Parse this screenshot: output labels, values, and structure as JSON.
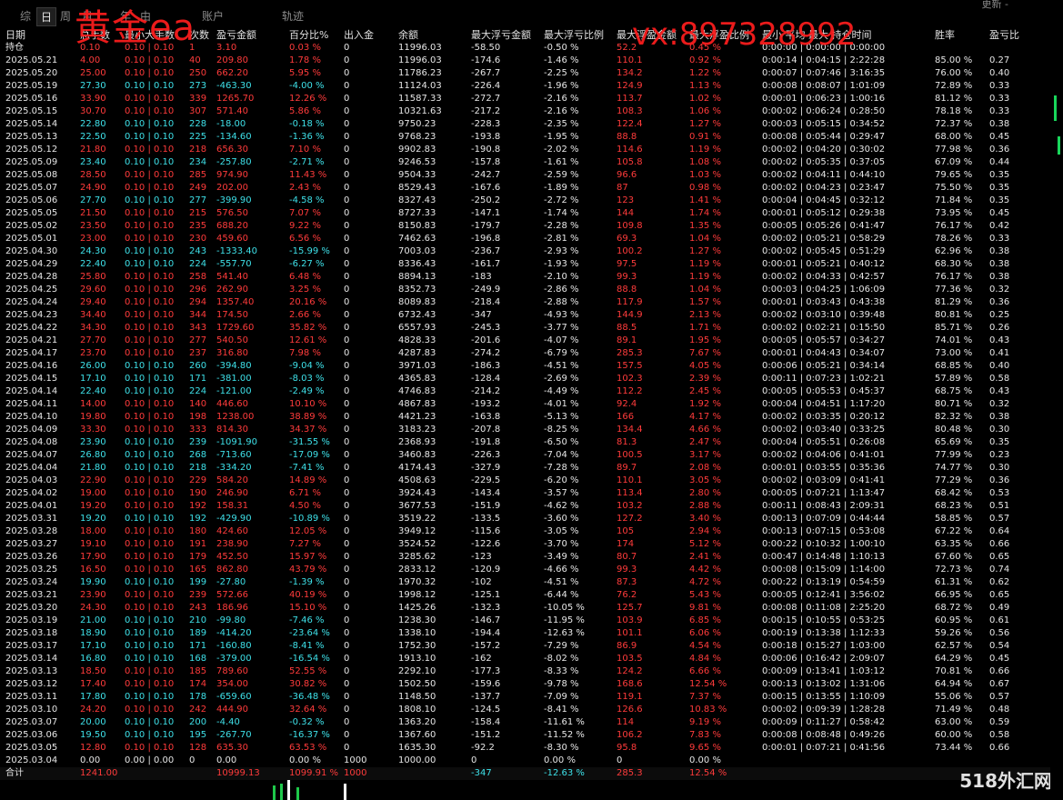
{
  "tabs": [
    "综",
    "日",
    "周",
    "月",
    "年",
    "由",
    "账户",
    "轨迹"
  ],
  "active_tab": "日",
  "watermark": {
    "title": "黄金ea",
    "contact": "vx:897328992",
    "logo": "518外汇网"
  },
  "top_right": "更新  -",
  "columns": [
    "日期",
    "总手数",
    "最小大手数",
    "次数",
    "盈亏金额",
    "百分比%",
    "出入金",
    "余额",
    "最大浮亏金额",
    "最大浮亏比例",
    "最大浮盈金额",
    "最大浮盈比例",
    "最小 平均 最大 持仓时间",
    "胜率",
    "盈亏比"
  ],
  "rows": [
    [
      "持仓",
      "0.10",
      "0.10 | 0.10",
      "1",
      "3.10",
      "0.03 %",
      "0",
      "11996.03",
      "-58.50",
      "-0.50 %",
      "52.2",
      "0.45 %",
      "0:00:00 | 0:00:00 | 0:00:00",
      "",
      ""
    ],
    [
      "2025.05.21",
      "4.00",
      "0.10 | 0.10",
      "40",
      "209.80",
      "1.78 %",
      "0",
      "11996.03",
      "-174.6",
      "-1.46 %",
      "110.1",
      "0.92 %",
      "0:00:14 | 0:04:15 | 2:22:28",
      "85.00 %",
      "0.27"
    ],
    [
      "2025.05.20",
      "25.00",
      "0.10 | 0.10",
      "250",
      "662.20",
      "5.95 %",
      "0",
      "11786.23",
      "-267.7",
      "-2.25 %",
      "134.2",
      "1.22 %",
      "0:00:07 | 0:07:46 | 3:16:35",
      "76.00 %",
      "0.40"
    ],
    [
      "2025.05.19",
      "27.30",
      "0.10 | 0.10",
      "273",
      "-463.30",
      "-4.00 %",
      "0",
      "11124.03",
      "-226.4",
      "-1.96 %",
      "124.9",
      "1.13 %",
      "0:00:08 | 0:08:07 | 1:01:09",
      "72.89 %",
      "0.33"
    ],
    [
      "2025.05.16",
      "33.90",
      "0.10 | 0.10",
      "339",
      "1265.70",
      "12.26 %",
      "0",
      "11587.33",
      "-272.7",
      "-2.16 %",
      "113.7",
      "1.02 %",
      "0:00:01 | 0:06:23 | 1:00:16",
      "81.12 %",
      "0.33"
    ],
    [
      "2025.05.15",
      "30.70",
      "0.10 | 0.10",
      "307",
      "571.40",
      "5.86 %",
      "0",
      "10321.63",
      "-217.2",
      "-2.16 %",
      "108.3",
      "1.06 %",
      "0:00:02 | 0:06:24 | 0:28:50",
      "78.18 %",
      "0.33"
    ],
    [
      "2025.05.14",
      "22.80",
      "0.10 | 0.10",
      "228",
      "-18.00",
      "-0.18 %",
      "0",
      "9750.23",
      "-228.3",
      "-2.35 %",
      "122.4",
      "1.27 %",
      "0:00:03 | 0:05:15 | 0:34:52",
      "72.37 %",
      "0.38"
    ],
    [
      "2025.05.13",
      "22.50",
      "0.10 | 0.10",
      "225",
      "-134.60",
      "-1.36 %",
      "0",
      "9768.23",
      "-193.8",
      "-1.95 %",
      "88.8",
      "0.91 %",
      "0:00:08 | 0:05:44 | 0:29:47",
      "68.00 %",
      "0.45"
    ],
    [
      "2025.05.12",
      "21.80",
      "0.10 | 0.10",
      "218",
      "656.30",
      "7.10 %",
      "0",
      "9902.83",
      "-190.8",
      "-2.02 %",
      "114.6",
      "1.19 %",
      "0:00:02 | 0:04:20 | 0:30:02",
      "77.98 %",
      "0.36"
    ],
    [
      "2025.05.09",
      "23.40",
      "0.10 | 0.10",
      "234",
      "-257.80",
      "-2.71 %",
      "0",
      "9246.53",
      "-157.8",
      "-1.61 %",
      "105.8",
      "1.08 %",
      "0:00:02 | 0:05:35 | 0:37:05",
      "67.09 %",
      "0.44"
    ],
    [
      "2025.05.08",
      "28.50",
      "0.10 | 0.10",
      "285",
      "974.90",
      "11.43 %",
      "0",
      "9504.33",
      "-242.7",
      "-2.59 %",
      "96.6",
      "1.03 %",
      "0:00:02 | 0:04:11 | 0:44:10",
      "79.65 %",
      "0.35"
    ],
    [
      "2025.05.07",
      "24.90",
      "0.10 | 0.10",
      "249",
      "202.00",
      "2.43 %",
      "0",
      "8529.43",
      "-167.6",
      "-1.89 %",
      "87",
      "0.98 %",
      "0:00:02 | 0:04:23 | 0:23:47",
      "75.50 %",
      "0.35"
    ],
    [
      "2025.05.06",
      "27.70",
      "0.10 | 0.10",
      "277",
      "-399.90",
      "-4.58 %",
      "0",
      "8327.43",
      "-250.2",
      "-2.72 %",
      "123",
      "1.41 %",
      "0:00:04 | 0:04:45 | 0:32:12",
      "71.84 %",
      "0.35"
    ],
    [
      "2025.05.05",
      "21.50",
      "0.10 | 0.10",
      "215",
      "576.50",
      "7.07 %",
      "0",
      "8727.33",
      "-147.1",
      "-1.74 %",
      "144",
      "1.74 %",
      "0:00:01 | 0:05:12 | 0:29:38",
      "73.95 %",
      "0.45"
    ],
    [
      "2025.05.02",
      "23.50",
      "0.10 | 0.10",
      "235",
      "688.20",
      "9.22 %",
      "0",
      "8150.83",
      "-179.7",
      "-2.28 %",
      "109.8",
      "1.35 %",
      "0:00:05 | 0:05:26 | 0:41:47",
      "76.17 %",
      "0.42"
    ],
    [
      "2025.05.01",
      "23.00",
      "0.10 | 0.10",
      "230",
      "459.60",
      "6.56 %",
      "0",
      "7462.63",
      "-196.8",
      "-2.81 %",
      "69.3",
      "1.04 %",
      "0:00:02 | 0:05:21 | 0:58:29",
      "78.26 %",
      "0.33"
    ],
    [
      "2025.04.30",
      "24.30",
      "0.10 | 0.10",
      "243",
      "-1333.40",
      "-15.99 %",
      "0",
      "7003.03",
      "-236.7",
      "-2.93 %",
      "100.2",
      "1.27 %",
      "0:00:02 | 0:05:45 | 0:51:29",
      "62.96 %",
      "0.38"
    ],
    [
      "2025.04.29",
      "22.40",
      "0.10 | 0.10",
      "224",
      "-557.70",
      "-6.27 %",
      "0",
      "8336.43",
      "-161.7",
      "-1.93 %",
      "97.5",
      "1.19 %",
      "0:00:01 | 0:05:21 | 0:40:12",
      "68.30 %",
      "0.38"
    ],
    [
      "2025.04.28",
      "25.80",
      "0.10 | 0.10",
      "258",
      "541.40",
      "6.48 %",
      "0",
      "8894.13",
      "-183",
      "-2.10 %",
      "99.3",
      "1.19 %",
      "0:00:02 | 0:04:33 | 0:42:57",
      "76.17 %",
      "0.38"
    ],
    [
      "2025.04.25",
      "29.60",
      "0.10 | 0.10",
      "296",
      "262.90",
      "3.25 %",
      "0",
      "8352.73",
      "-249.9",
      "-2.86 %",
      "88.8",
      "1.04 %",
      "0:00:03 | 0:04:25 | 1:06:09",
      "77.36 %",
      "0.32"
    ],
    [
      "2025.04.24",
      "29.40",
      "0.10 | 0.10",
      "294",
      "1357.40",
      "20.16 %",
      "0",
      "8089.83",
      "-218.4",
      "-2.88 %",
      "117.9",
      "1.57 %",
      "0:00:01 | 0:03:43 | 0:43:38",
      "81.29 %",
      "0.36"
    ],
    [
      "2025.04.23",
      "34.40",
      "0.10 | 0.10",
      "344",
      "174.50",
      "2.66 %",
      "0",
      "6732.43",
      "-347",
      "-4.93 %",
      "144.9",
      "2.13 %",
      "0:00:02 | 0:03:10 | 0:39:48",
      "80.81 %",
      "0.25"
    ],
    [
      "2025.04.22",
      "34.30",
      "0.10 | 0.10",
      "343",
      "1729.60",
      "35.82 %",
      "0",
      "6557.93",
      "-245.3",
      "-3.77 %",
      "88.5",
      "1.71 %",
      "0:00:02 | 0:02:21 | 0:15:50",
      "85.71 %",
      "0.26"
    ],
    [
      "2025.04.21",
      "27.70",
      "0.10 | 0.10",
      "277",
      "540.50",
      "12.61 %",
      "0",
      "4828.33",
      "-201.6",
      "-4.07 %",
      "89.1",
      "1.95 %",
      "0:00:05 | 0:05:57 | 0:34:27",
      "74.01 %",
      "0.43"
    ],
    [
      "2025.04.17",
      "23.70",
      "0.10 | 0.10",
      "237",
      "316.80",
      "7.98 %",
      "0",
      "4287.83",
      "-274.2",
      "-6.79 %",
      "285.3",
      "7.67 %",
      "0:00:01 | 0:04:43 | 0:34:07",
      "73.00 %",
      "0.41"
    ],
    [
      "2025.04.16",
      "26.00",
      "0.10 | 0.10",
      "260",
      "-394.80",
      "-9.04 %",
      "0",
      "3971.03",
      "-186.3",
      "-4.51 %",
      "157.5",
      "4.05 %",
      "0:00:06 | 0:05:21 | 0:34:14",
      "68.85 %",
      "0.40"
    ],
    [
      "2025.04.15",
      "17.10",
      "0.10 | 0.10",
      "171",
      "-381.00",
      "-8.03 %",
      "0",
      "4365.83",
      "-128.4",
      "-2.69 %",
      "102.3",
      "2.39 %",
      "0:00:11 | 0:07:23 | 1:02:21",
      "57.89 %",
      "0.58"
    ],
    [
      "2025.04.14",
      "22.40",
      "0.10 | 0.10",
      "224",
      "-121.00",
      "-2.49 %",
      "0",
      "4746.83",
      "-214.2",
      "-4.49 %",
      "112.2",
      "2.45 %",
      "0:00:05 | 0:05:53 | 0:45:37",
      "68.75 %",
      "0.43"
    ],
    [
      "2025.04.11",
      "14.00",
      "0.10 | 0.10",
      "140",
      "446.60",
      "10.10 %",
      "0",
      "4867.83",
      "-193.2",
      "-4.01 %",
      "92.4",
      "1.92 %",
      "0:00:04 | 0:04:51 | 1:17:20",
      "80.71 %",
      "0.32"
    ],
    [
      "2025.04.10",
      "19.80",
      "0.10 | 0.10",
      "198",
      "1238.00",
      "38.89 %",
      "0",
      "4421.23",
      "-163.8",
      "-5.13 %",
      "166",
      "4.17 %",
      "0:00:02 | 0:03:35 | 0:20:12",
      "82.32 %",
      "0.38"
    ],
    [
      "2025.04.09",
      "33.30",
      "0.10 | 0.10",
      "333",
      "814.30",
      "34.37 %",
      "0",
      "3183.23",
      "-207.8",
      "-8.25 %",
      "134.4",
      "4.66 %",
      "0:00:02 | 0:03:40 | 0:33:25",
      "80.48 %",
      "0.30"
    ],
    [
      "2025.04.08",
      "23.90",
      "0.10 | 0.10",
      "239",
      "-1091.90",
      "-31.55 %",
      "0",
      "2368.93",
      "-191.8",
      "-6.50 %",
      "81.3",
      "2.47 %",
      "0:00:04 | 0:05:51 | 0:26:08",
      "65.69 %",
      "0.35"
    ],
    [
      "2025.04.07",
      "26.80",
      "0.10 | 0.10",
      "268",
      "-713.60",
      "-17.09 %",
      "0",
      "3460.83",
      "-226.3",
      "-7.04 %",
      "100.5",
      "3.17 %",
      "0:00:02 | 0:04:06 | 0:41:01",
      "77.99 %",
      "0.23"
    ],
    [
      "2025.04.04",
      "21.80",
      "0.10 | 0.10",
      "218",
      "-334.20",
      "-7.41 %",
      "0",
      "4174.43",
      "-327.9",
      "-7.28 %",
      "89.7",
      "2.08 %",
      "0:00:01 | 0:03:55 | 0:35:36",
      "74.77 %",
      "0.30"
    ],
    [
      "2025.04.03",
      "22.90",
      "0.10 | 0.10",
      "229",
      "584.20",
      "14.89 %",
      "0",
      "4508.63",
      "-229.5",
      "-6.20 %",
      "110.1",
      "3.05 %",
      "0:00:02 | 0:03:09 | 0:41:41",
      "77.29 %",
      "0.36"
    ],
    [
      "2025.04.02",
      "19.00",
      "0.10 | 0.10",
      "190",
      "246.90",
      "6.71 %",
      "0",
      "3924.43",
      "-143.4",
      "-3.57 %",
      "113.4",
      "2.80 %",
      "0:00:05 | 0:07:21 | 1:13:47",
      "68.42 %",
      "0.53"
    ],
    [
      "2025.04.01",
      "19.20",
      "0.10 | 0.10",
      "192",
      "158.31",
      "4.50 %",
      "0",
      "3677.53",
      "-151.9",
      "-4.62 %",
      "103.2",
      "2.88 %",
      "0:00:11 | 0:08:43 | 2:09:31",
      "68.23 %",
      "0.51"
    ],
    [
      "2025.03.31",
      "19.20",
      "0.10 | 0.10",
      "192",
      "-429.90",
      "-10.89 %",
      "0",
      "3519.22",
      "-133.5",
      "-3.60 %",
      "127.2",
      "3.40 %",
      "0:00:13 | 0:07:09 | 0:44:44",
      "58.85 %",
      "0.57"
    ],
    [
      "2025.03.28",
      "18.00",
      "0.10 | 0.10",
      "180",
      "424.60",
      "12.05 %",
      "0",
      "3949.12",
      "-115.6",
      "-3.05 %",
      "105",
      "2.94 %",
      "0:00:13 | 0:07:15 | 0:53:08",
      "67.22 %",
      "0.64"
    ],
    [
      "2025.03.27",
      "19.10",
      "0.10 | 0.10",
      "191",
      "238.90",
      "7.27 %",
      "0",
      "3524.52",
      "-122.6",
      "-3.70 %",
      "174",
      "5.12 %",
      "0:00:22 | 0:10:32 | 1:00:10",
      "63.35 %",
      "0.66"
    ],
    [
      "2025.03.26",
      "17.90",
      "0.10 | 0.10",
      "179",
      "452.50",
      "15.97 %",
      "0",
      "3285.62",
      "-123",
      "-3.49 %",
      "80.7",
      "2.41 %",
      "0:00:47 | 0:14:48 | 1:10:13",
      "67.60 %",
      "0.65"
    ],
    [
      "2025.03.25",
      "16.50",
      "0.10 | 0.10",
      "165",
      "862.80",
      "43.79 %",
      "0",
      "2833.12",
      "-120.9",
      "-4.66 %",
      "99.3",
      "4.42 %",
      "0:00:08 | 0:15:09 | 1:14:00",
      "72.73 %",
      "0.74"
    ],
    [
      "2025.03.24",
      "19.90",
      "0.10 | 0.10",
      "199",
      "-27.80",
      "-1.39 %",
      "0",
      "1970.32",
      "-102",
      "-4.51 %",
      "87.3",
      "4.72 %",
      "0:00:22 | 0:13:19 | 0:54:59",
      "61.31 %",
      "0.62"
    ],
    [
      "2025.03.21",
      "23.90",
      "0.10 | 0.10",
      "239",
      "572.66",
      "40.19 %",
      "0",
      "1998.12",
      "-125.1",
      "-6.44 %",
      "76.2",
      "5.43 %",
      "0:00:05 | 0:12:41 | 3:56:02",
      "66.95 %",
      "0.65"
    ],
    [
      "2025.03.20",
      "24.30",
      "0.10 | 0.10",
      "243",
      "186.96",
      "15.10 %",
      "0",
      "1425.26",
      "-132.3",
      "-10.05 %",
      "125.7",
      "9.81 %",
      "0:00:08 | 0:11:08 | 2:25:20",
      "68.72 %",
      "0.49"
    ],
    [
      "2025.03.19",
      "21.00",
      "0.10 | 0.10",
      "210",
      "-99.80",
      "-7.46 %",
      "0",
      "1238.30",
      "-146.7",
      "-11.95 %",
      "103.9",
      "6.85 %",
      "0:00:15 | 0:10:55 | 0:53:25",
      "60.95 %",
      "0.61"
    ],
    [
      "2025.03.18",
      "18.90",
      "0.10 | 0.10",
      "189",
      "-414.20",
      "-23.64 %",
      "0",
      "1338.10",
      "-194.4",
      "-12.63 %",
      "101.1",
      "6.06 %",
      "0:00:19 | 0:13:38 | 1:12:33",
      "59.26 %",
      "0.56"
    ],
    [
      "2025.03.17",
      "17.10",
      "0.10 | 0.10",
      "171",
      "-160.80",
      "-8.41 %",
      "0",
      "1752.30",
      "-157.2",
      "-7.29 %",
      "86.9",
      "4.54 %",
      "0:00:18 | 0:15:27 | 1:03:00",
      "62.57 %",
      "0.54"
    ],
    [
      "2025.03.14",
      "16.80",
      "0.10 | 0.10",
      "168",
      "-379.00",
      "-16.54 %",
      "0",
      "1913.10",
      "-162",
      "-8.02 %",
      "103.5",
      "4.84 %",
      "0:00:06 | 0:16:42 | 2:09:07",
      "64.29 %",
      "0.45"
    ],
    [
      "2025.03.13",
      "18.50",
      "0.10 | 0.10",
      "185",
      "789.60",
      "52.55 %",
      "0",
      "2292.10",
      "-177.3",
      "-8.33 %",
      "124.2",
      "6.66 %",
      "0:00:09 | 0:13:41 | 1:03:12",
      "70.81 %",
      "0.66"
    ],
    [
      "2025.03.12",
      "17.40",
      "0.10 | 0.10",
      "174",
      "354.00",
      "30.82 %",
      "0",
      "1502.50",
      "-159.6",
      "-9.78 %",
      "168.6",
      "12.54 %",
      "0:00:13 | 0:13:02 | 1:31:06",
      "64.94 %",
      "0.67"
    ],
    [
      "2025.03.11",
      "17.80",
      "0.10 | 0.10",
      "178",
      "-659.60",
      "-36.48 %",
      "0",
      "1148.50",
      "-137.7",
      "-7.09 %",
      "119.1",
      "7.37 %",
      "0:00:15 | 0:13:55 | 1:10:09",
      "55.06 %",
      "0.57"
    ],
    [
      "2025.03.10",
      "24.20",
      "0.10 | 0.10",
      "242",
      "444.90",
      "32.64 %",
      "0",
      "1808.10",
      "-124.5",
      "-8.41 %",
      "126.6",
      "10.83 %",
      "0:00:02 | 0:09:39 | 1:28:28",
      "71.49 %",
      "0.48"
    ],
    [
      "2025.03.07",
      "20.00",
      "0.10 | 0.10",
      "200",
      "-4.40",
      "-0.32 %",
      "0",
      "1363.20",
      "-158.4",
      "-11.61 %",
      "114",
      "9.19 %",
      "0:00:09 | 0:11:27 | 0:58:42",
      "63.00 %",
      "0.59"
    ],
    [
      "2025.03.06",
      "19.50",
      "0.10 | 0.10",
      "195",
      "-267.70",
      "-16.37 %",
      "0",
      "1367.60",
      "-151.2",
      "-11.52 %",
      "106.2",
      "7.83 %",
      "0:00:08 | 0:08:48 | 0:49:26",
      "60.00 %",
      "0.58"
    ],
    [
      "2025.03.05",
      "12.80",
      "0.10 | 0.10",
      "128",
      "635.30",
      "63.53 %",
      "0",
      "1635.30",
      "-92.2",
      "-8.30 %",
      "95.8",
      "9.65 %",
      "0:00:01 | 0:07:21 | 0:41:56",
      "73.44 %",
      "0.66"
    ],
    [
      "2025.03.04",
      "0.00",
      "0.00 | 0.00",
      "0",
      "0.00",
      "0.00 %",
      "1000",
      "1000.00",
      "0",
      "0.00 %",
      "0",
      "0.00 %",
      "",
      "",
      ""
    ]
  ],
  "total": [
    "合计",
    "1241.00",
    "",
    "",
    "10999.13",
    "1099.91 %",
    "1000",
    "",
    "-347",
    "-12.63 %",
    "285.3",
    "12.54 %",
    "",
    "",
    ""
  ],
  "colors": {
    "positive": "#ff3b3b",
    "negative": "#3ee0e8",
    "neutral": "#d8d8d8",
    "background": "#000000"
  }
}
